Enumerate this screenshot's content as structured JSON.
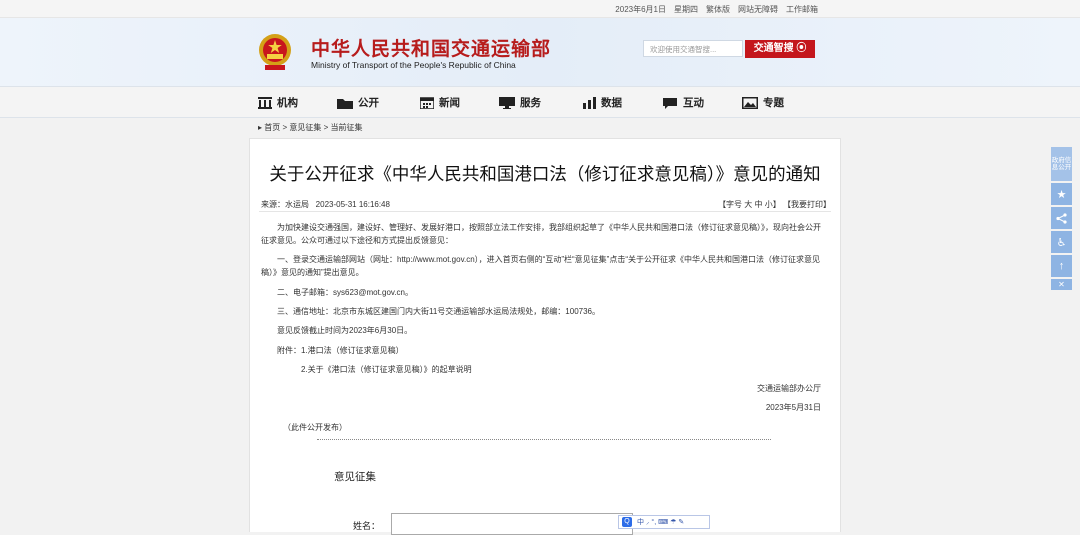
{
  "topbar": {
    "date": "2023年6月1日",
    "weekday": "星期四",
    "traditional": "繁体版",
    "accessibility": "网站无障碍",
    "webmail": "工作邮箱"
  },
  "header": {
    "title": "中华人民共和国交通运输部",
    "subtitle": "Ministry of Transport of the People's Republic of China",
    "search_placeholder": "欢迎使用交通智搜...",
    "search_button": "交通智搜"
  },
  "nav": {
    "items": [
      {
        "label": "机构",
        "icon": "building-icon"
      },
      {
        "label": "公开",
        "icon": "folder-icon"
      },
      {
        "label": "新闻",
        "icon": "calendar-icon"
      },
      {
        "label": "服务",
        "icon": "monitor-icon"
      },
      {
        "label": "数据",
        "icon": "bar-chart-icon"
      },
      {
        "label": "互动",
        "icon": "chat-icon"
      },
      {
        "label": "专题",
        "icon": "image-icon"
      }
    ]
  },
  "breadcrumb": {
    "home": "首页",
    "sep1": ">",
    "section": "意见征集",
    "sep2": ">",
    "current": "当前征集"
  },
  "article": {
    "title": "关于公开征求《中华人民共和国港口法（修订征求意见稿）》意见的通知",
    "source": "来源：水运局",
    "datetime": "2023-05-31 16:16:48",
    "font_size_label": "【字号",
    "font_large": "大",
    "font_medium": "中",
    "font_small": "小】",
    "print": "【我要打印】",
    "p1": "　　为加快建设交通强国，建设好、管理好、发展好港口，按照部立法工作安排，我部组织起草了《中华人民共和国港口法（修订征求意见稿）》，现向社会公开征求意见。公众可通过以下途径和方式提出反馈意见：",
    "p2": "　　一、登录交通运输部网站（网址：http://www.mot.gov.cn），进入首页右侧的“互动”栏“意见征集”点击“关于公开征求《中华人民共和国港口法（修订征求意见稿）》意见的通知”提出意见。",
    "p3": "　　二、电子邮箱：sys623@mot.gov.cn。",
    "p4": "　　三、通信地址：北京市东城区建国门内大街11号交通运输部水运局法规处，邮编：100736。",
    "p5": "　　意见反馈截止时间为2023年6月30日。",
    "p6": "　　附件：1.港口法（修订征求意见稿）",
    "p7": "　　　　　2.关于《港口法（修订征求意见稿）》的起草说明",
    "signer": "交通运输部办公厅",
    "sign_date": "2023年5月31日",
    "note": "（此件公开发布）"
  },
  "feedback": {
    "section_title": "意见征集",
    "name_label": "姓名："
  },
  "ime": {
    "text": "中 ⸝ °, ⌨ ☂ ✎"
  },
  "sidebar": {
    "gov_info": "政府信息公开"
  },
  "colors": {
    "brand_red": "#c4161c",
    "title_red": "#b71c1c",
    "sidebar_blue": "#8eb4e3"
  }
}
